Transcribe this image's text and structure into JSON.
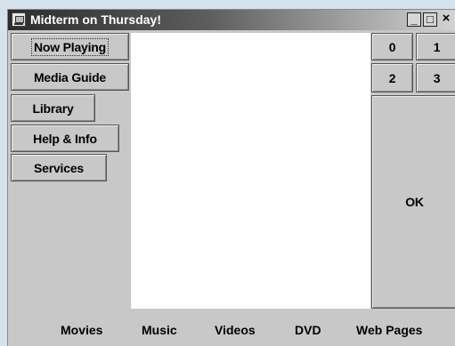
{
  "window": {
    "title": "Midterm on Thursday!",
    "controls": {
      "minimize": "_",
      "maximize": "□",
      "close": "×"
    }
  },
  "menu": {
    "items": [
      {
        "label": "Now Playing"
      },
      {
        "label": "Media Guide"
      },
      {
        "label": "Library"
      },
      {
        "label": "Help & Info"
      },
      {
        "label": "Services"
      }
    ]
  },
  "keypad": {
    "keys": [
      "0",
      "1",
      "2",
      "3"
    ],
    "ok_label": "OK"
  },
  "bottom_nav": {
    "items": [
      "Movies",
      "Music",
      "Videos",
      "DVD",
      "Web Pages"
    ]
  }
}
